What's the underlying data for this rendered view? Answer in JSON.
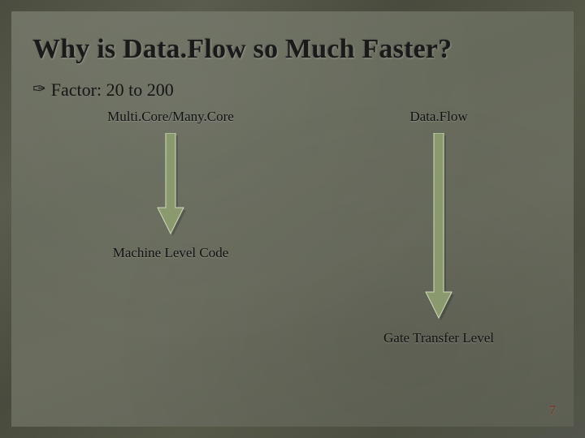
{
  "slide": {
    "title": "Why is Data.Flow so Much Faster?",
    "bullet": "Factor: 20 to 200",
    "left": {
      "top_label": "Multi.Core/Many.Core",
      "bottom_label": "Machine Level Code"
    },
    "right": {
      "top_label": "Data.Flow",
      "bottom_label": "Gate Transfer Level"
    },
    "page_number": "7"
  },
  "colors": {
    "arrow_fill": "#8a9a6e",
    "arrow_stroke": "#cfd9bf"
  }
}
